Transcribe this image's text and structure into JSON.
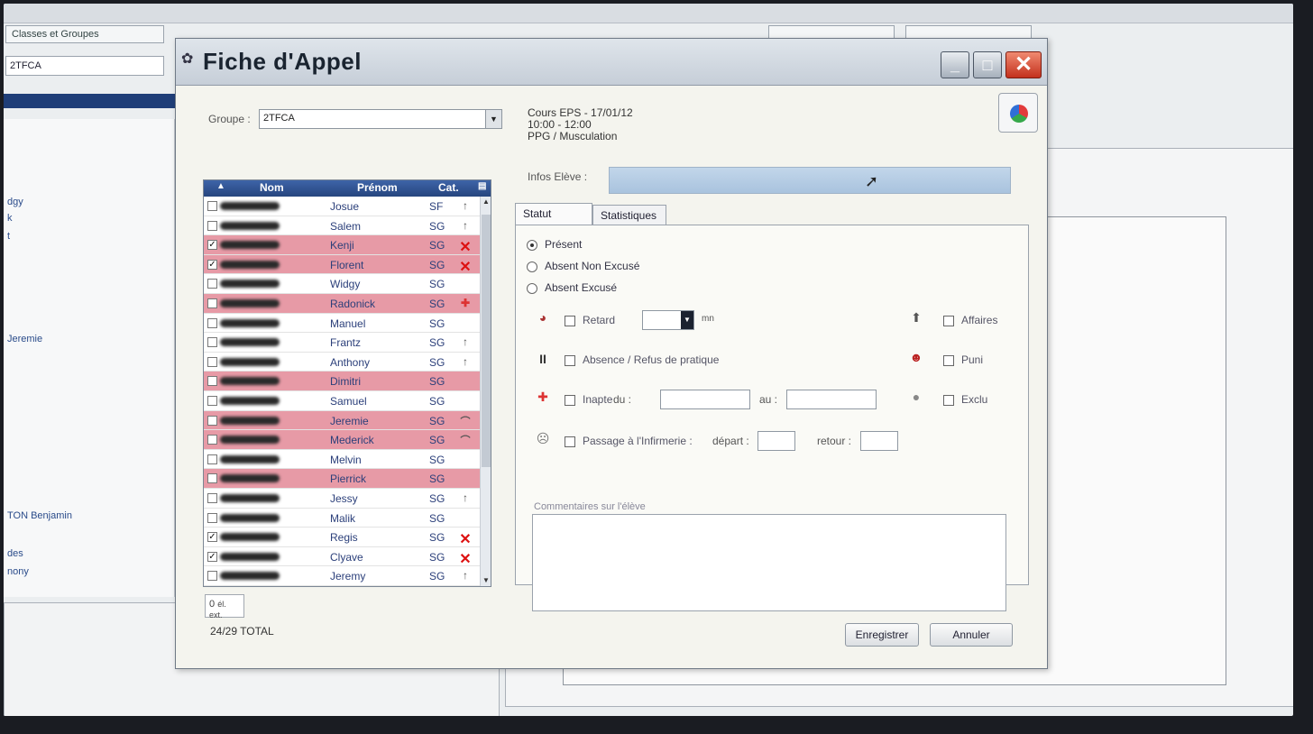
{
  "background_app": {
    "tab1": "Classes et Groupes",
    "field": "2TFCA",
    "list_items": [
      "dgy",
      "k",
      "t",
      "Jeremie",
      "TON Benjamin",
      "des",
      "nony"
    ]
  },
  "dialog": {
    "title": "Fiche d'Appel",
    "window_buttons": {
      "minimize": "_",
      "maximize": "□",
      "close": "✕"
    },
    "groupe_label": "Groupe :",
    "groupe_value": "2TFCA",
    "cours_line1": "Cours EPS - 17/01/12",
    "cours_line2": "10:00 - 12:00",
    "cours_line3": "PPG / Musculation",
    "infos_label": "Infos Elève :"
  },
  "table": {
    "headers": {
      "nom": "Nom",
      "prenom": "Prénom",
      "cat": "Cat."
    },
    "rows": [
      {
        "checked": false,
        "prenom": "Josue",
        "cat": "SF",
        "mark": "↑",
        "status": "normal"
      },
      {
        "checked": false,
        "prenom": "Salem",
        "cat": "SG",
        "mark": "↑",
        "status": "normal"
      },
      {
        "checked": true,
        "prenom": "Kenji",
        "cat": "SG",
        "mark": "✕",
        "status": "absent"
      },
      {
        "checked": true,
        "prenom": "Florent",
        "cat": "SG",
        "mark": "✕",
        "status": "absent"
      },
      {
        "checked": false,
        "prenom": "Widgy",
        "cat": "SG",
        "mark": "",
        "status": "normal"
      },
      {
        "checked": false,
        "prenom": "Radonick",
        "cat": "SG",
        "mark": "✚",
        "status": "absent"
      },
      {
        "checked": false,
        "prenom": "Manuel",
        "cat": "SG",
        "mark": "",
        "status": "normal"
      },
      {
        "checked": false,
        "prenom": "Frantz",
        "cat": "SG",
        "mark": "↑",
        "status": "normal"
      },
      {
        "checked": false,
        "prenom": "Anthony",
        "cat": "SG",
        "mark": "↑",
        "status": "normal"
      },
      {
        "checked": false,
        "prenom": "Dimitri",
        "cat": "SG",
        "mark": "",
        "status": "absent"
      },
      {
        "checked": false,
        "prenom": "Samuel",
        "cat": "SG",
        "mark": "",
        "status": "normal"
      },
      {
        "checked": false,
        "prenom": "Jeremie",
        "cat": "SG",
        "mark": "⌒",
        "status": "absent"
      },
      {
        "checked": false,
        "prenom": "Mederick",
        "cat": "SG",
        "mark": "⌒",
        "status": "absent"
      },
      {
        "checked": false,
        "prenom": "Melvin",
        "cat": "SG",
        "mark": "",
        "status": "normal"
      },
      {
        "checked": false,
        "prenom": "Pierrick",
        "cat": "SG",
        "mark": "",
        "status": "absent"
      },
      {
        "checked": false,
        "prenom": "Jessy",
        "cat": "SG",
        "mark": "↑",
        "status": "normal"
      },
      {
        "checked": false,
        "prenom": "Malik",
        "cat": "SG",
        "mark": "",
        "status": "normal"
      },
      {
        "checked": true,
        "prenom": "Regis",
        "cat": "SG",
        "mark": "✕",
        "status": "normal"
      },
      {
        "checked": true,
        "prenom": "Clyave",
        "cat": "SG",
        "mark": "✕",
        "status": "normal"
      },
      {
        "checked": false,
        "prenom": "Jeremy",
        "cat": "SG",
        "mark": "↑",
        "status": "normal"
      }
    ],
    "count_value": "0",
    "count_suffix": "él. ext.",
    "total": "24/29 TOTAL"
  },
  "tabs": {
    "statut": "Statut",
    "statistiques": "Statistiques"
  },
  "statut": {
    "present": "Présent",
    "absent_non_excuse": "Absent Non Excusé",
    "absent_excuse": "Absent Excusé",
    "retard": "Retard",
    "retard_unit": "mn",
    "absence_refus": "Absence / Refus de pratique",
    "inapte": "Inapte",
    "du": "du :",
    "au": "au :",
    "infirmerie": "Passage à l'Infirmerie :",
    "depart": "départ :",
    "retour": "retour :",
    "affaires": "Affaires",
    "puni": "Puni",
    "exclu": "Exclu",
    "comment_label": "Commentaires sur l'élève"
  },
  "buttons": {
    "save": "Enregistrer",
    "cancel": "Annuler"
  }
}
